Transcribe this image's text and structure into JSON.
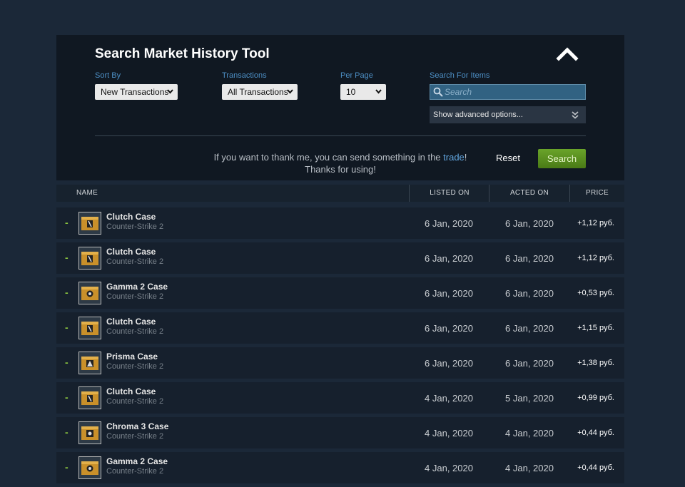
{
  "panel": {
    "title": "Search Market History Tool",
    "sort_by": {
      "label": "Sort By",
      "value": "New Transactions"
    },
    "transactions": {
      "label": "Transactions",
      "value": "All Transactions"
    },
    "per_page": {
      "label": "Per Page",
      "value": "10"
    },
    "search": {
      "label": "Search For Items",
      "placeholder": "Search",
      "value": ""
    },
    "advanced_label": "Show advanced options...",
    "thanks_before": "If you want to thank me, you can send something in the ",
    "thanks_link": "trade",
    "thanks_after": "!",
    "thanks_line2": "Thanks for using!",
    "reset_label": "Reset",
    "search_label": "Search"
  },
  "table": {
    "headers": {
      "name": "NAME",
      "listed": "LISTED ON",
      "acted": "ACTED ON",
      "price": "PRICE"
    },
    "rows": [
      {
        "marker": "-",
        "name": "Clutch Case",
        "game": "Counter-Strike 2",
        "listed": "6 Jan, 2020",
        "acted": "6 Jan, 2020",
        "price": "+1,12 руб.",
        "icon": "clutch-case-icon"
      },
      {
        "marker": "-",
        "name": "Clutch Case",
        "game": "Counter-Strike 2",
        "listed": "6 Jan, 2020",
        "acted": "6 Jan, 2020",
        "price": "+1,12 руб.",
        "icon": "clutch-case-icon"
      },
      {
        "marker": "-",
        "name": "Gamma 2 Case",
        "game": "Counter-Strike 2",
        "listed": "6 Jan, 2020",
        "acted": "6 Jan, 2020",
        "price": "+0,53 руб.",
        "icon": "gamma-case-icon"
      },
      {
        "marker": "-",
        "name": "Clutch Case",
        "game": "Counter-Strike 2",
        "listed": "6 Jan, 2020",
        "acted": "6 Jan, 2020",
        "price": "+1,15 руб.",
        "icon": "clutch-case-icon"
      },
      {
        "marker": "-",
        "name": "Prisma Case",
        "game": "Counter-Strike 2",
        "listed": "6 Jan, 2020",
        "acted": "6 Jan, 2020",
        "price": "+1,38 руб.",
        "icon": "prisma-case-icon"
      },
      {
        "marker": "-",
        "name": "Clutch Case",
        "game": "Counter-Strike 2",
        "listed": "4 Jan, 2020",
        "acted": "5 Jan, 2020",
        "price": "+0,99 руб.",
        "icon": "clutch-case-icon"
      },
      {
        "marker": "-",
        "name": "Chroma 3 Case",
        "game": "Counter-Strike 2",
        "listed": "4 Jan, 2020",
        "acted": "4 Jan, 2020",
        "price": "+0,44 руб.",
        "icon": "chroma-case-icon"
      },
      {
        "marker": "-",
        "name": "Gamma 2 Case",
        "game": "Counter-Strike 2",
        "listed": "4 Jan, 2020",
        "acted": "4 Jan, 2020",
        "price": "+0,44 руб.",
        "icon": "gamma-case-icon"
      }
    ]
  },
  "colors": {
    "background": "#1b2838",
    "panel": "#101822",
    "accent_blue": "#4d8fc5",
    "search_green": "#5c9a1f",
    "marker_green": "#8bc53f"
  }
}
